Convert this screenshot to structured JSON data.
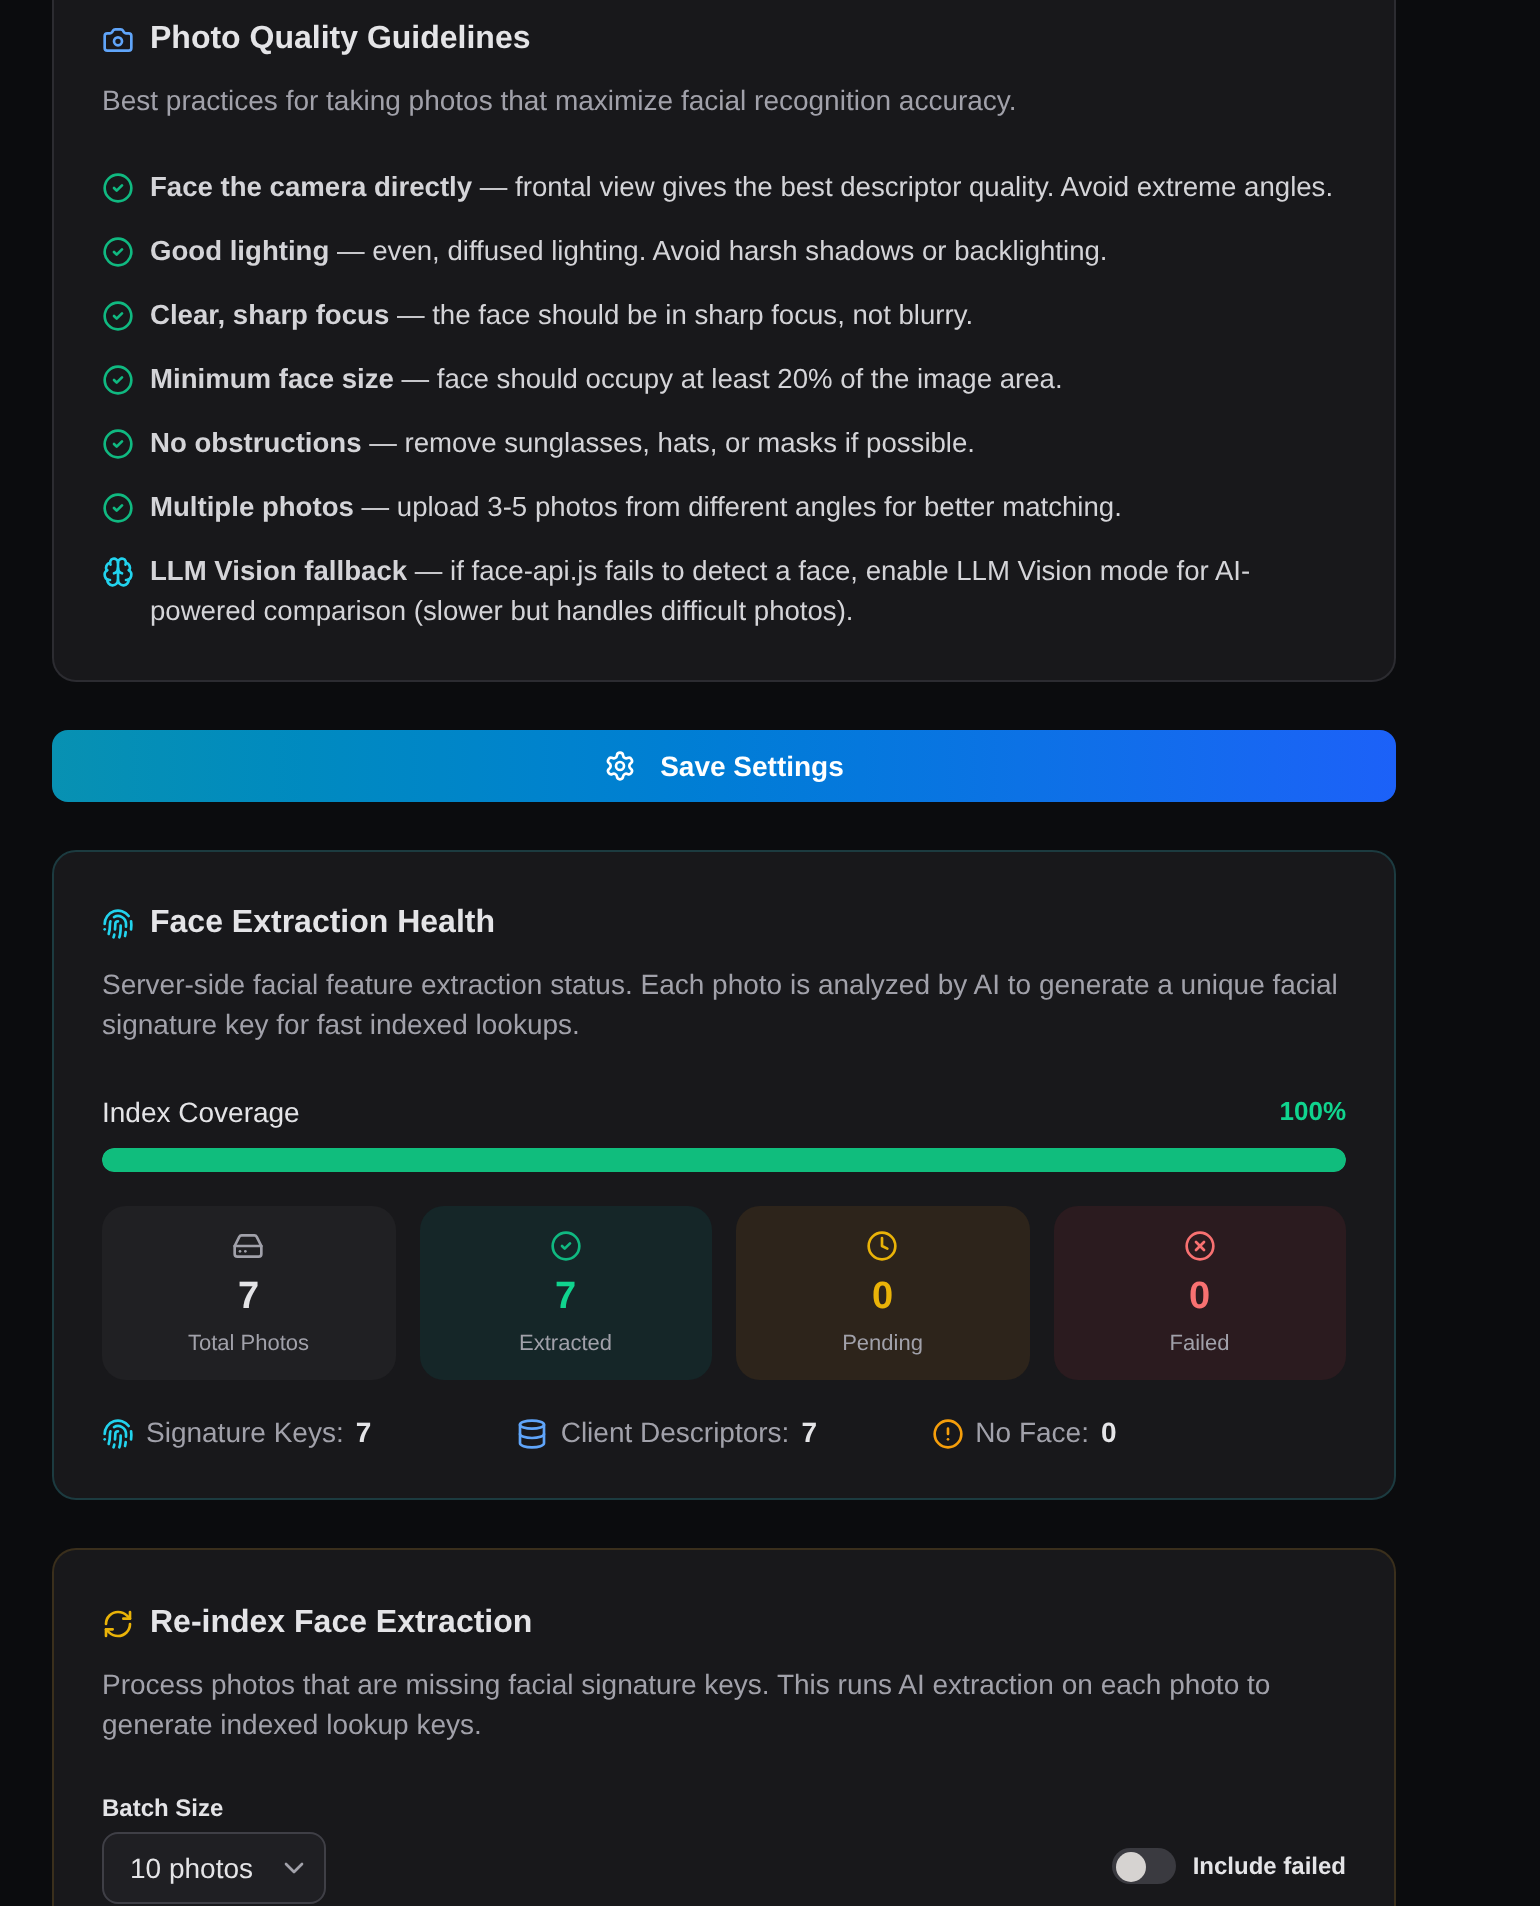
{
  "guidelines": {
    "title": "Photo Quality Guidelines",
    "description": "Best practices for taking photos that maximize facial recognition accuracy.",
    "items": [
      {
        "kind": "check",
        "text": "**Face the camera directly** — frontal view gives the best descriptor quality. Avoid extreme angles."
      },
      {
        "kind": "check",
        "text": "**Good lighting** — even, diffused lighting. Avoid harsh shadows or backlighting."
      },
      {
        "kind": "check",
        "text": "**Clear, sharp focus** — the face should be in sharp focus, not blurry."
      },
      {
        "kind": "check",
        "text": "**Minimum face size** — face should occupy at least 20% of the image area."
      },
      {
        "kind": "check",
        "text": "**No obstructions** — remove sunglasses, hats, or masks if possible."
      },
      {
        "kind": "check",
        "text": "**Multiple photos** — upload 3-5 photos from different angles for better matching."
      },
      {
        "kind": "brain",
        "text": "**LLM Vision fallback** — if face-api.js fails to detect a face, enable LLM Vision mode for AI-powered comparison (slower but handles difficult photos)."
      }
    ]
  },
  "save_button": {
    "label": "Save Settings"
  },
  "health": {
    "title": "Face Extraction Health",
    "description": "Server-side facial feature extraction status. Each photo is analyzed by AI to generate a unique facial signature key for fast indexed lookups.",
    "coverage": {
      "label": "Index Coverage",
      "value": "100%",
      "level": 1
    },
    "stats": [
      {
        "kind": "total",
        "value": "7",
        "label": "Total Photos"
      },
      {
        "kind": "extracted",
        "value": "7",
        "label": "Extracted"
      },
      {
        "kind": "pending",
        "value": "0",
        "label": "Pending"
      },
      {
        "kind": "failed",
        "value": "0",
        "label": "Failed"
      }
    ],
    "summary": [
      {
        "kind": "signature",
        "label": "Signature Keys:",
        "value": "7"
      },
      {
        "kind": "descriptors",
        "label": "Client Descriptors:",
        "value": "7"
      },
      {
        "kind": "no_face",
        "label": "No Face:",
        "value": "0"
      }
    ]
  },
  "reindex": {
    "title": "Re-index Face Extraction",
    "description": "Process photos that are missing facial signature keys. This runs AI extraction on each photo to generate indexed lookup keys.",
    "batch_size": {
      "label": "Batch Size",
      "value": "10 photos"
    },
    "include_failed": {
      "label": "Include failed",
      "on": false
    }
  }
}
